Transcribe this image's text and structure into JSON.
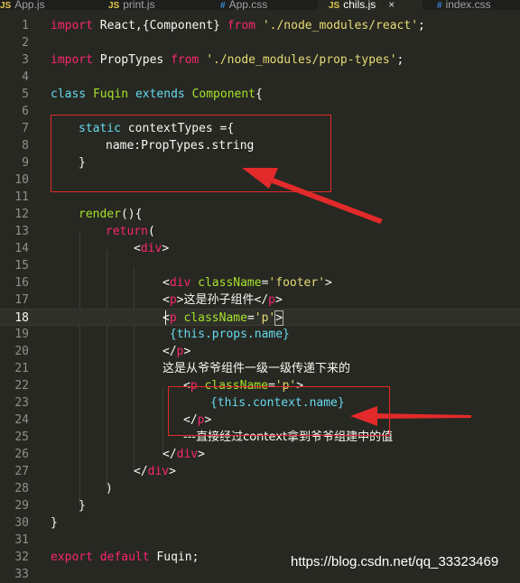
{
  "tabs": [
    {
      "icon": "JS",
      "name": "App.js"
    },
    {
      "icon": "JS",
      "name": "print.js"
    },
    {
      "icon": "#",
      "name": "App.css"
    },
    {
      "icon": "JS",
      "name": "chils.js",
      "close": "×"
    },
    {
      "icon": "#",
      "name": "index.css"
    }
  ],
  "line_numbers": [
    "1",
    "2",
    "3",
    "4",
    "5",
    "6",
    "7",
    "8",
    "9",
    "10",
    "11",
    "12",
    "13",
    "14",
    "15",
    "16",
    "17",
    "18",
    "19",
    "20",
    "21",
    "22",
    "23",
    "24",
    "25",
    "26",
    "27",
    "28",
    "29",
    "30",
    "31",
    "32",
    "33"
  ],
  "current_line": "18",
  "code": {
    "l1": {
      "kw": "import",
      "mid": " React,{Component} ",
      "kw2": "from",
      "sp": " ",
      "str": "'./node_modules/react'",
      "end": ";"
    },
    "l3": {
      "kw": "import",
      "mid": " PropTypes ",
      "kw2": "from",
      "sp": " ",
      "str": "'./node_modules/prop-types'",
      "end": ";"
    },
    "l5": {
      "kw": "class",
      "sp": " ",
      "name": "Fuqin",
      "sp2": " ",
      "kw2": "extends",
      "sp3": " ",
      "parent": "Component",
      "end": "{"
    },
    "l7": {
      "kw": "static",
      "sp": " ",
      "name": "contextTypes",
      "end": " ={"
    },
    "l8": {
      "text": "name:PropTypes.string"
    },
    "l9": {
      "text": "}"
    },
    "l12": {
      "name": "render",
      "end": "(){"
    },
    "l13": {
      "kw": "return",
      "end": "("
    },
    "l14": {
      "lt": "<",
      "tag": "div",
      "gt": ">"
    },
    "l16": {
      "lt": "<",
      "tag": "div",
      "sp": " ",
      "attr": "className",
      "eq": "=",
      "str": "'footer'",
      "gt": ">"
    },
    "l17": {
      "lt": "<",
      "tag": "p",
      "gt": ">",
      "text": "这是孙子组件",
      "lt2": "</",
      "tag2": "p",
      "gt2": ">"
    },
    "l18": {
      "lt": "<",
      "tag": "p",
      "sp": " ",
      "attr": "className",
      "eq": "=",
      "str": "'p'",
      "gt": ">"
    },
    "l19": {
      "text": " {this.props.name}"
    },
    "l20": {
      "lt": "</",
      "tag": "p",
      "gt": ">"
    },
    "l21": {
      "text": "这是从爷爷组件一级一级传递下来的"
    },
    "l22": {
      "lt": "<",
      "tag": "p",
      "sp": " ",
      "attr": "className",
      "eq": "=",
      "str": "'p'",
      "gt": ">"
    },
    "l23": {
      "text": "{this.context.name}"
    },
    "l24": {
      "lt": "</",
      "tag": "p",
      "gt": ">"
    },
    "l25": {
      "text": "---直接经过context拿到爷爷组建中的值"
    },
    "l26": {
      "lt": "</",
      "tag": "div",
      "gt": ">"
    },
    "l27": {
      "lt": "</",
      "tag": "div",
      "gt": ">"
    },
    "l28": {
      "text": ")"
    },
    "l29": {
      "text": "}"
    },
    "l30": {
      "text": "}"
    },
    "l32": {
      "kw": "export",
      "sp": " ",
      "kw2": "default",
      "sp2": " ",
      "name": "Fuqin",
      "end": ";"
    }
  },
  "watermark": "https://blog.csdn.net/qq_33323469",
  "colors": {
    "background": "#272822",
    "keyword": "#66d9ef",
    "string": "#e6db74",
    "tag": "#f92672",
    "class": "#a6e22e",
    "annotation": "#e22a2a"
  }
}
